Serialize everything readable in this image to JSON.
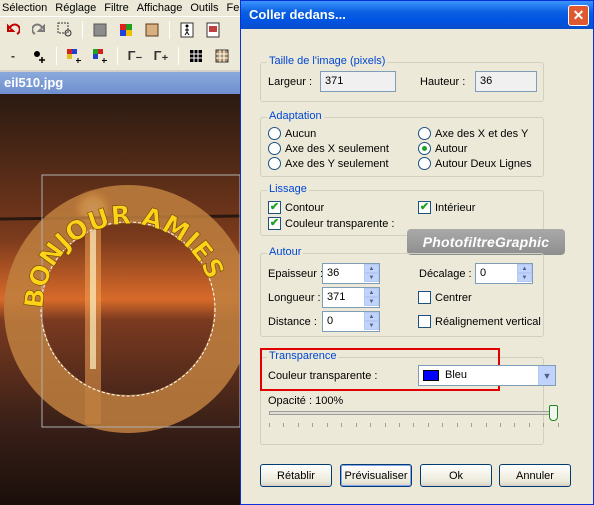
{
  "app": {
    "menu": [
      "Sélection",
      "Réglage",
      "Filtre",
      "Affichage",
      "Outils",
      "Fenêtre",
      "?"
    ],
    "document_tab": "eil510.jpg",
    "canvas_text": "BONJOUR AMIES"
  },
  "dialog": {
    "title": "Coller dedans...",
    "close": "✕",
    "image_size": {
      "legend": "Taille de l'image (pixels)",
      "width_label": "Largeur :",
      "width_value": "371",
      "height_label": "Hauteur :",
      "height_value": "36"
    },
    "adaptation": {
      "legend": "Adaptation",
      "options": [
        "Aucun",
        "Axe des X seulement",
        "Axe des Y seulement",
        "Axe des X et des Y",
        "Autour",
        "Autour Deux Lignes"
      ],
      "selected": "Autour"
    },
    "lissage": {
      "legend": "Lissage",
      "contour": "Contour",
      "contour_checked": true,
      "couleur_transparente": "Couleur transparente :",
      "couleur_transparente_checked": true,
      "interieur": "Intérieur",
      "interieur_checked": true
    },
    "watermark": "PhotofiltreGraphic",
    "autour": {
      "legend": "Autour",
      "epaisseur_label": "Epaisseur :",
      "epaisseur_value": "36",
      "longueur_label": "Longueur :",
      "longueur_value": "371",
      "distance_label": "Distance :",
      "distance_value": "0",
      "decalage_label": "Décalage :",
      "decalage_value": "0",
      "centrer": "Centrer",
      "centrer_checked": false,
      "realignement": "Réalignement vertical",
      "realignement_checked": false
    },
    "transparence": {
      "legend": "Transparence",
      "couleur_label": "Couleur transparente :",
      "couleur_value": "Bleu",
      "couleur_hex": "#0000ff",
      "opacite_label": "Opacité : 100%",
      "opacite_value": 1.0
    },
    "buttons": {
      "retablir": "Rétablir",
      "previsualiser": "Prévisualiser",
      "ok": "Ok",
      "annuler": "Annuler"
    }
  }
}
